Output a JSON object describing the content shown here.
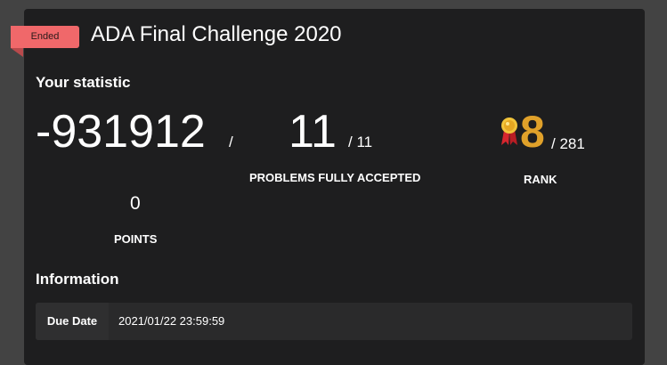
{
  "contest": {
    "status": "Ended",
    "title": "ADA Final Challenge 2020"
  },
  "statistic": {
    "heading": "Your statistic",
    "score": "-931912",
    "score_sep": "/",
    "points_value": "0",
    "points_label": "POINTS",
    "solved": "11",
    "solved_total": "/ 11",
    "solved_label": "PROBLEMS FULLY ACCEPTED",
    "rank": "8",
    "rank_total": "/ 281",
    "rank_label": "RANK",
    "medal_icon": "gold-medal-icon"
  },
  "information": {
    "heading": "Information",
    "rows": [
      {
        "key": "Due Date",
        "value": "2021/01/22 23:59:59"
      }
    ]
  },
  "colors": {
    "ribbon": "#f0686a",
    "rank": "#e0a12a",
    "card": "#1e1e1f",
    "background": "#434343"
  }
}
